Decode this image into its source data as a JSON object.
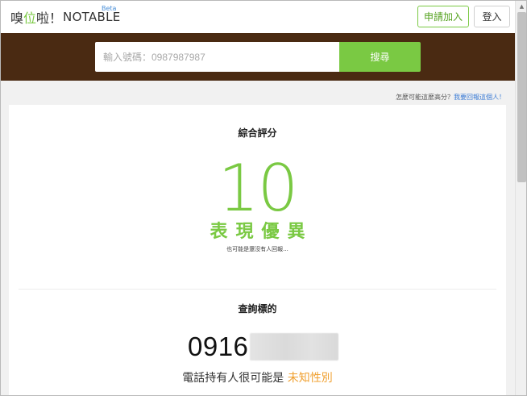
{
  "header": {
    "logo": {
      "part1": "嗅",
      "part2": "位",
      "part3": "啦！",
      "brand": "NOTABLE",
      "beta": "Beta"
    },
    "apply_label": "申請加入",
    "login_label": "登入"
  },
  "search": {
    "placeholder": "輸入號碼：0987987987",
    "button_label": "搜尋"
  },
  "report": {
    "question": "怎麼可能這麼高分？",
    "link": "我要回報這個人！"
  },
  "rating": {
    "title": "綜合評分",
    "score": "10",
    "label": "表現優異",
    "note": "也可能是還沒有人回報..."
  },
  "query": {
    "title": "查詢標的",
    "phone_prefix": "0916",
    "owner_text": "電話持有人很可能是 ",
    "gender": "未知性別"
  },
  "colors": {
    "brand_green": "#7ac943",
    "search_band": "#4a2a12",
    "link_blue": "#3a7bd5",
    "gender_orange": "#f0a030"
  }
}
